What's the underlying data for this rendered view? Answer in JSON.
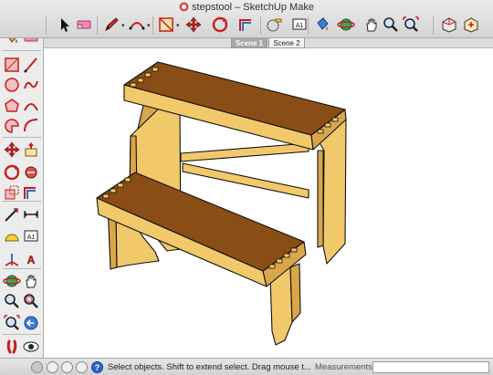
{
  "window": {
    "title": "stepstool – SketchUp Make"
  },
  "toolbar": {
    "items": [
      {
        "icon": "select-arrow-icon"
      },
      {
        "icon": "eraser-icon"
      },
      {
        "icon": "pencil-icon"
      },
      {
        "icon": "arc-icon"
      },
      {
        "icon": "push-pull-icon"
      },
      {
        "icon": "move-icon"
      },
      {
        "icon": "rotate-icon"
      },
      {
        "icon": "offset-icon"
      },
      {
        "icon": "tape-measure-icon"
      },
      {
        "icon": "text-icon",
        "text": "A1"
      },
      {
        "icon": "paint-bucket-icon"
      },
      {
        "icon": "orbit-icon"
      },
      {
        "icon": "pan-icon"
      },
      {
        "icon": "zoom-icon"
      },
      {
        "icon": "zoom-extents-icon"
      },
      {
        "icon": "3d-warehouse-icon"
      },
      {
        "icon": "extension-warehouse-icon"
      }
    ]
  },
  "scenes": {
    "tabs": [
      "Scene 1",
      "Scene 2"
    ],
    "active": "Scene 1"
  },
  "palette": {
    "tools": [
      "select",
      "make-component",
      "paint-bucket",
      "eraser",
      "rectangle",
      "line",
      "circle",
      "freehand",
      "polygon",
      "arc",
      "pie",
      "two-point-arc",
      "move",
      "push-pull",
      "rotate",
      "follow-me",
      "scale",
      "offset",
      "tape-measure",
      "dimension",
      "protractor",
      "text",
      "axes",
      "3d-text",
      "orbit",
      "pan",
      "zoom",
      "zoom-window",
      "zoom-extents",
      "previous-view",
      "walk",
      "look-around",
      "position-camera",
      "section-plane"
    ],
    "text_tool_label": "A1"
  },
  "status": {
    "text": "Select objects. Shift to extend select. Drag mouse t...",
    "measurements_label": "Measurements",
    "measurements_value": ""
  },
  "colors": {
    "wood_side": "#f2c96a",
    "wood_dark": "#d9a64a",
    "tread_top": "#8a4d16",
    "outline": "#111111"
  }
}
